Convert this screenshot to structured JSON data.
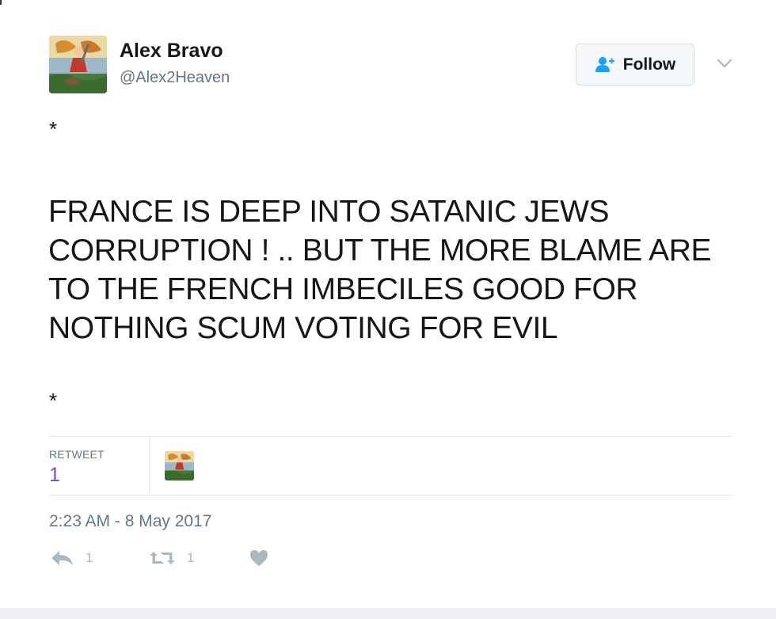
{
  "author": {
    "display_name": "Alex Bravo",
    "screen_name": "@Alex2Heaven",
    "avatar_icon": "archangel-painting-avatar"
  },
  "follow_button": {
    "label": "Follow",
    "icon": "add-user-icon"
  },
  "tweet": {
    "pre_marker": "*",
    "text": "FRANCE IS DEEP INTO SATANIC JEWS CORRUPTION ! .. BUT THE MORE BLAME ARE TO THE FRENCH IMBECILES GOOD FOR NOTHING SCUM VOTING FOR EVIL",
    "post_marker": "*"
  },
  "stats": {
    "retweet_label": "RETWEET",
    "retweet_count": "1"
  },
  "timestamp": "2:23 AM - 8 May 2017",
  "actions": {
    "reply_count": "1",
    "retweet_count": "1",
    "like_icon": "heart-icon"
  },
  "colors": {
    "retweet_count": "#794bc4",
    "muted": "#657786",
    "action_icons": "#aab8c2",
    "follow_bg": "#f5f8fa",
    "follow_icon": "#1da1f2"
  }
}
